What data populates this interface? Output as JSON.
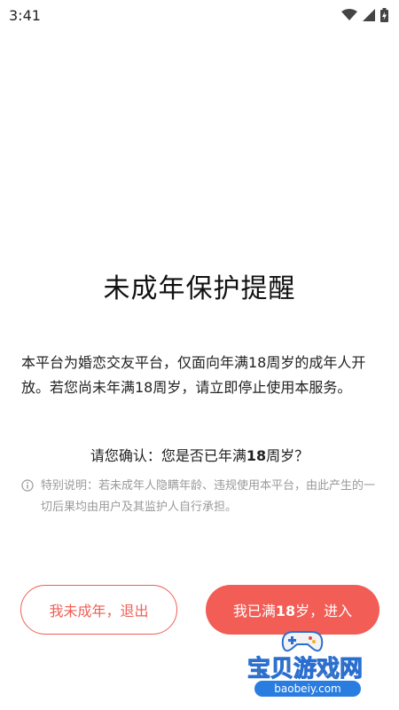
{
  "status_bar": {
    "time": "3:41",
    "icons": [
      "wifi-icon",
      "cell-signal-icon",
      "battery-icon"
    ]
  },
  "dialog": {
    "title": "未成年保护提醒",
    "paragraph": "本平台为婚恋交友平台，仅面向年满18周岁的成年人开放。若您尚未年满18周岁，请立即停止使用本服务。",
    "question_prefix": "请您确认：您是否已年满",
    "question_bold": "18",
    "question_suffix": "周岁？",
    "notice": "特别说明：若未成年人隐瞒年龄、违规使用本平台，由此产生的一切后果均由用户及其监护人自行承担。"
  },
  "buttons": {
    "exit_label": "我未成年，退出",
    "enter_prefix": "我已满",
    "enter_bold": "18",
    "enter_suffix": "岁，进入"
  },
  "watermark": {
    "name": "宝贝游戏网",
    "url": "baobeiy.com"
  },
  "colors": {
    "accent": "#f25d56",
    "notice_text": "#9a9a9a"
  }
}
